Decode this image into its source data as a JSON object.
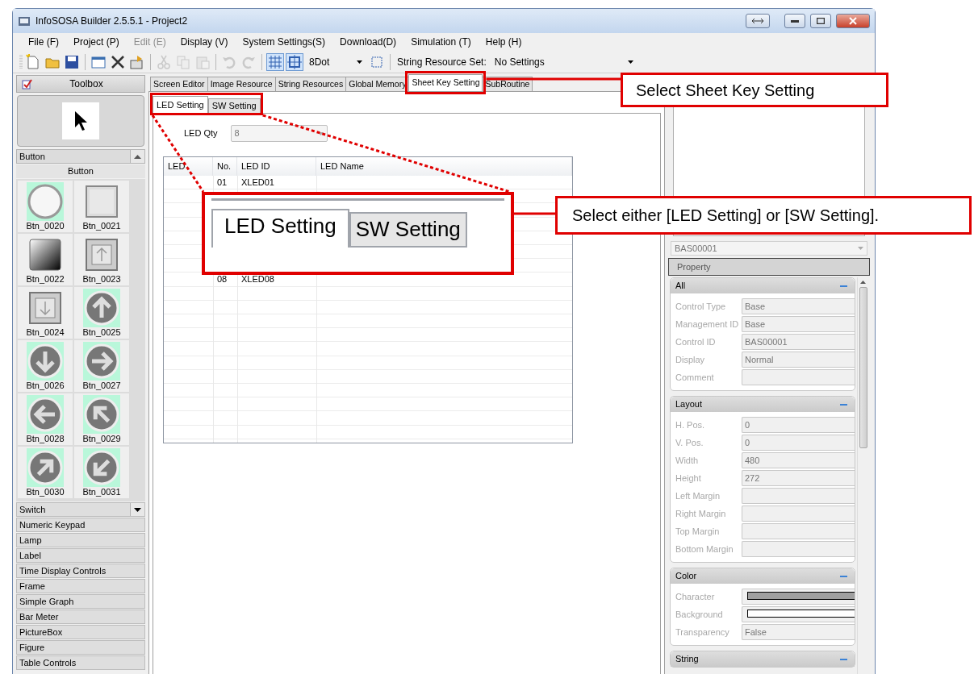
{
  "window": {
    "title": "InfoSOSA Builder 2.5.5.1 - Project2"
  },
  "menu": [
    {
      "label": "File (F)",
      "disabled": false
    },
    {
      "label": "Project (P)",
      "disabled": false
    },
    {
      "label": "Edit (E)",
      "disabled": true
    },
    {
      "label": "Display (V)",
      "disabled": false
    },
    {
      "label": "System Settings(S)",
      "disabled": false
    },
    {
      "label": "Download(D)",
      "disabled": false
    },
    {
      "label": "Simulation (T)",
      "disabled": false
    },
    {
      "label": "Help (H)",
      "disabled": false
    }
  ],
  "toolbar": {
    "buttons": [
      {
        "kind": "new",
        "disabled": false
      },
      {
        "kind": "open",
        "disabled": false
      },
      {
        "kind": "save",
        "disabled": false
      },
      {
        "kind": "sep"
      },
      {
        "kind": "screen",
        "disabled": false
      },
      {
        "kind": "delete",
        "disabled": false
      },
      {
        "kind": "props",
        "disabled": false
      },
      {
        "kind": "sep"
      },
      {
        "kind": "cut",
        "disabled": true
      },
      {
        "kind": "copy",
        "disabled": true
      },
      {
        "kind": "paste",
        "disabled": true
      },
      {
        "kind": "sep"
      },
      {
        "kind": "undo",
        "disabled": true
      },
      {
        "kind": "redo",
        "disabled": true
      },
      {
        "kind": "sep"
      },
      {
        "kind": "grid",
        "disabled": false
      },
      {
        "kind": "snap",
        "disabled": false
      }
    ],
    "grid_combo": "8Dot",
    "string_resource_label": "String Resource Set:",
    "string_resource_value": "No Settings"
  },
  "toolbox": {
    "title": "Toolbox",
    "group": "Button",
    "subgroup": "Button",
    "items": [
      {
        "label": "Btn_0020",
        "kind": "circle",
        "tinted": true
      },
      {
        "label": "Btn_0021",
        "kind": "square",
        "tinted": false
      },
      {
        "label": "Btn_0022",
        "kind": "gradient",
        "tinted": false
      },
      {
        "label": "Btn_0023",
        "kind": "square-up",
        "tinted": false
      },
      {
        "label": "Btn_0024",
        "kind": "square-down",
        "tinted": false
      },
      {
        "label": "Btn_0025",
        "kind": "up",
        "tinted": true
      },
      {
        "label": "Btn_0026",
        "kind": "down",
        "tinted": true
      },
      {
        "label": "Btn_0027",
        "kind": "right",
        "tinted": true
      },
      {
        "label": "Btn_0028",
        "kind": "left",
        "tinted": true
      },
      {
        "label": "Btn_0029",
        "kind": "up-left",
        "tinted": true
      },
      {
        "label": "Btn_0030",
        "kind": "up-right",
        "tinted": true
      },
      {
        "label": "Btn_0031",
        "kind": "down-left",
        "tinted": true
      }
    ],
    "categories": [
      {
        "label": "Switch",
        "expandable": true
      },
      {
        "label": "Numeric Keypad",
        "expandable": false
      },
      {
        "label": "Lamp",
        "expandable": false
      },
      {
        "label": "Label",
        "expandable": false
      },
      {
        "label": "Time Display Controls",
        "expandable": false
      },
      {
        "label": "Frame",
        "expandable": false
      },
      {
        "label": "Simple Graph",
        "expandable": false
      },
      {
        "label": "Bar Meter",
        "expandable": false
      },
      {
        "label": "PictureBox",
        "expandable": false
      },
      {
        "label": "Figure",
        "expandable": false
      },
      {
        "label": "Table Controls",
        "expandable": false
      }
    ]
  },
  "tabs": [
    {
      "label": "Screen Editor",
      "selected": false
    },
    {
      "label": "Image Resource",
      "selected": false
    },
    {
      "label": "String Resources",
      "selected": false
    },
    {
      "label": "Global Memory",
      "selected": false
    },
    {
      "label": "Sheet Key Setting",
      "selected": true
    },
    {
      "label": "SubRoutine",
      "selected": false
    }
  ],
  "subtabs": [
    {
      "label": "LED Setting",
      "selected": true
    },
    {
      "label": "SW Setting",
      "selected": false
    }
  ],
  "led_qty": {
    "label": "LED Qty",
    "value": "8",
    "disabled": true
  },
  "table": {
    "columns": [
      "LED",
      "No.",
      "LED ID",
      "LED Name"
    ],
    "rows": [
      {
        "no": "01",
        "id": "XLED01"
      },
      {
        "no": "08",
        "id": "XLED08"
      }
    ]
  },
  "properties": {
    "selector": "BAS00001",
    "header": "Property",
    "sections": [
      {
        "title": "All",
        "fields": [
          {
            "label": "Control Type",
            "kind": "text",
            "value": "Base"
          },
          {
            "label": "Management ID",
            "kind": "text",
            "value": "Base"
          },
          {
            "label": "Control ID",
            "kind": "text",
            "value": "BAS00001"
          },
          {
            "label": "Display",
            "kind": "text",
            "value": "Normal"
          },
          {
            "label": "Comment",
            "kind": "text"
          }
        ]
      },
      {
        "title": "Layout",
        "fields": [
          {
            "label": "H. Pos.",
            "kind": "text",
            "value": "0"
          },
          {
            "label": "V. Pos.",
            "kind": "text",
            "value": "0"
          },
          {
            "label": "Width",
            "kind": "text",
            "value": "480"
          },
          {
            "label": "Height",
            "kind": "text",
            "value": "272"
          },
          {
            "label": "Left Margin",
            "kind": "text"
          },
          {
            "label": "Right Margin",
            "kind": "text"
          },
          {
            "label": "Top Margin",
            "kind": "text"
          },
          {
            "label": "Bottom Margin",
            "kind": "text"
          }
        ]
      },
      {
        "title": "Color",
        "fields": [
          {
            "label": "Character",
            "kind": "color",
            "color": "#a0a0a0"
          },
          {
            "label": "Background",
            "kind": "color",
            "color": "#ffffff"
          },
          {
            "label": "Transparency",
            "kind": "text",
            "value": "False"
          }
        ]
      },
      {
        "title": "String"
      }
    ]
  },
  "annotations": [
    {
      "text": "Select Sheet Key Setting"
    },
    {
      "text": "Select either [LED Setting] or [SW Setting]."
    }
  ],
  "inset": {
    "tabs": [
      {
        "label": "LED Setting",
        "selected": true
      },
      {
        "label": "SW Setting",
        "selected": false
      }
    ]
  }
}
